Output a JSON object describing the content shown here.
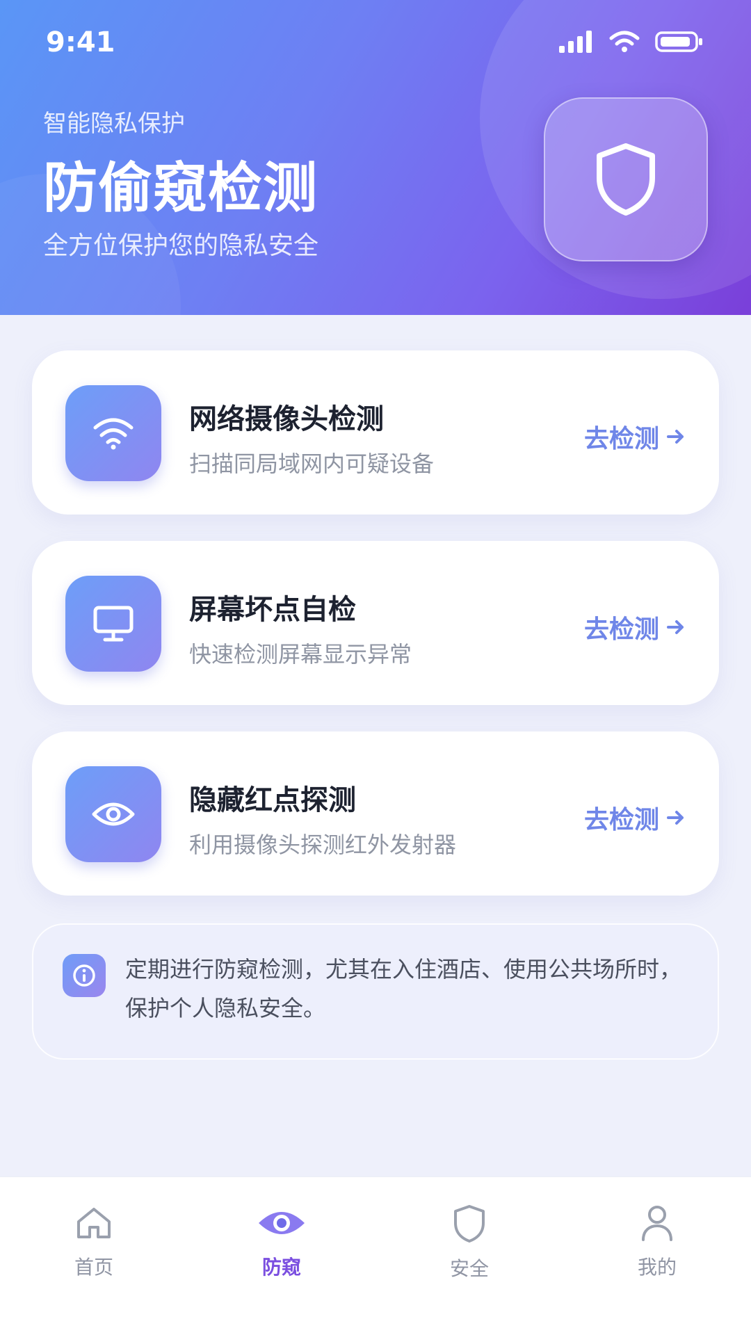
{
  "status": {
    "time": "9:41"
  },
  "header": {
    "kicker": "智能隐私保护",
    "title": "防偷窥检测",
    "subtitle": "全方位保护您的隐私安全",
    "badge_icon": "shield-icon"
  },
  "cards": [
    {
      "icon": "wifi-icon",
      "title": "网络摄像头检测",
      "desc": "扫描同局域网内可疑设备",
      "action": "去检测"
    },
    {
      "icon": "monitor-icon",
      "title": "屏幕坏点自检",
      "desc": "快速检测屏幕显示异常",
      "action": "去检测"
    },
    {
      "icon": "eye-icon",
      "title": "隐藏红点探测",
      "desc": "利用摄像头探测红外发射器",
      "action": "去检测"
    }
  ],
  "tip": {
    "icon": "info-icon",
    "text": "定期进行防窥检测，尤其在入住酒店、使用公共场所时，保护个人隐私安全。"
  },
  "nav": [
    {
      "icon": "home-icon",
      "label": "首页",
      "active": false
    },
    {
      "icon": "eye-icon",
      "label": "防窥",
      "active": true
    },
    {
      "icon": "shield-icon",
      "label": "安全",
      "active": false
    },
    {
      "icon": "user-icon",
      "label": "我的",
      "active": false
    }
  ],
  "colors": {
    "accent": "#7b4fe0",
    "action": "#6f86e8",
    "header_start": "#5a96f6",
    "header_end": "#7a3fd9"
  }
}
